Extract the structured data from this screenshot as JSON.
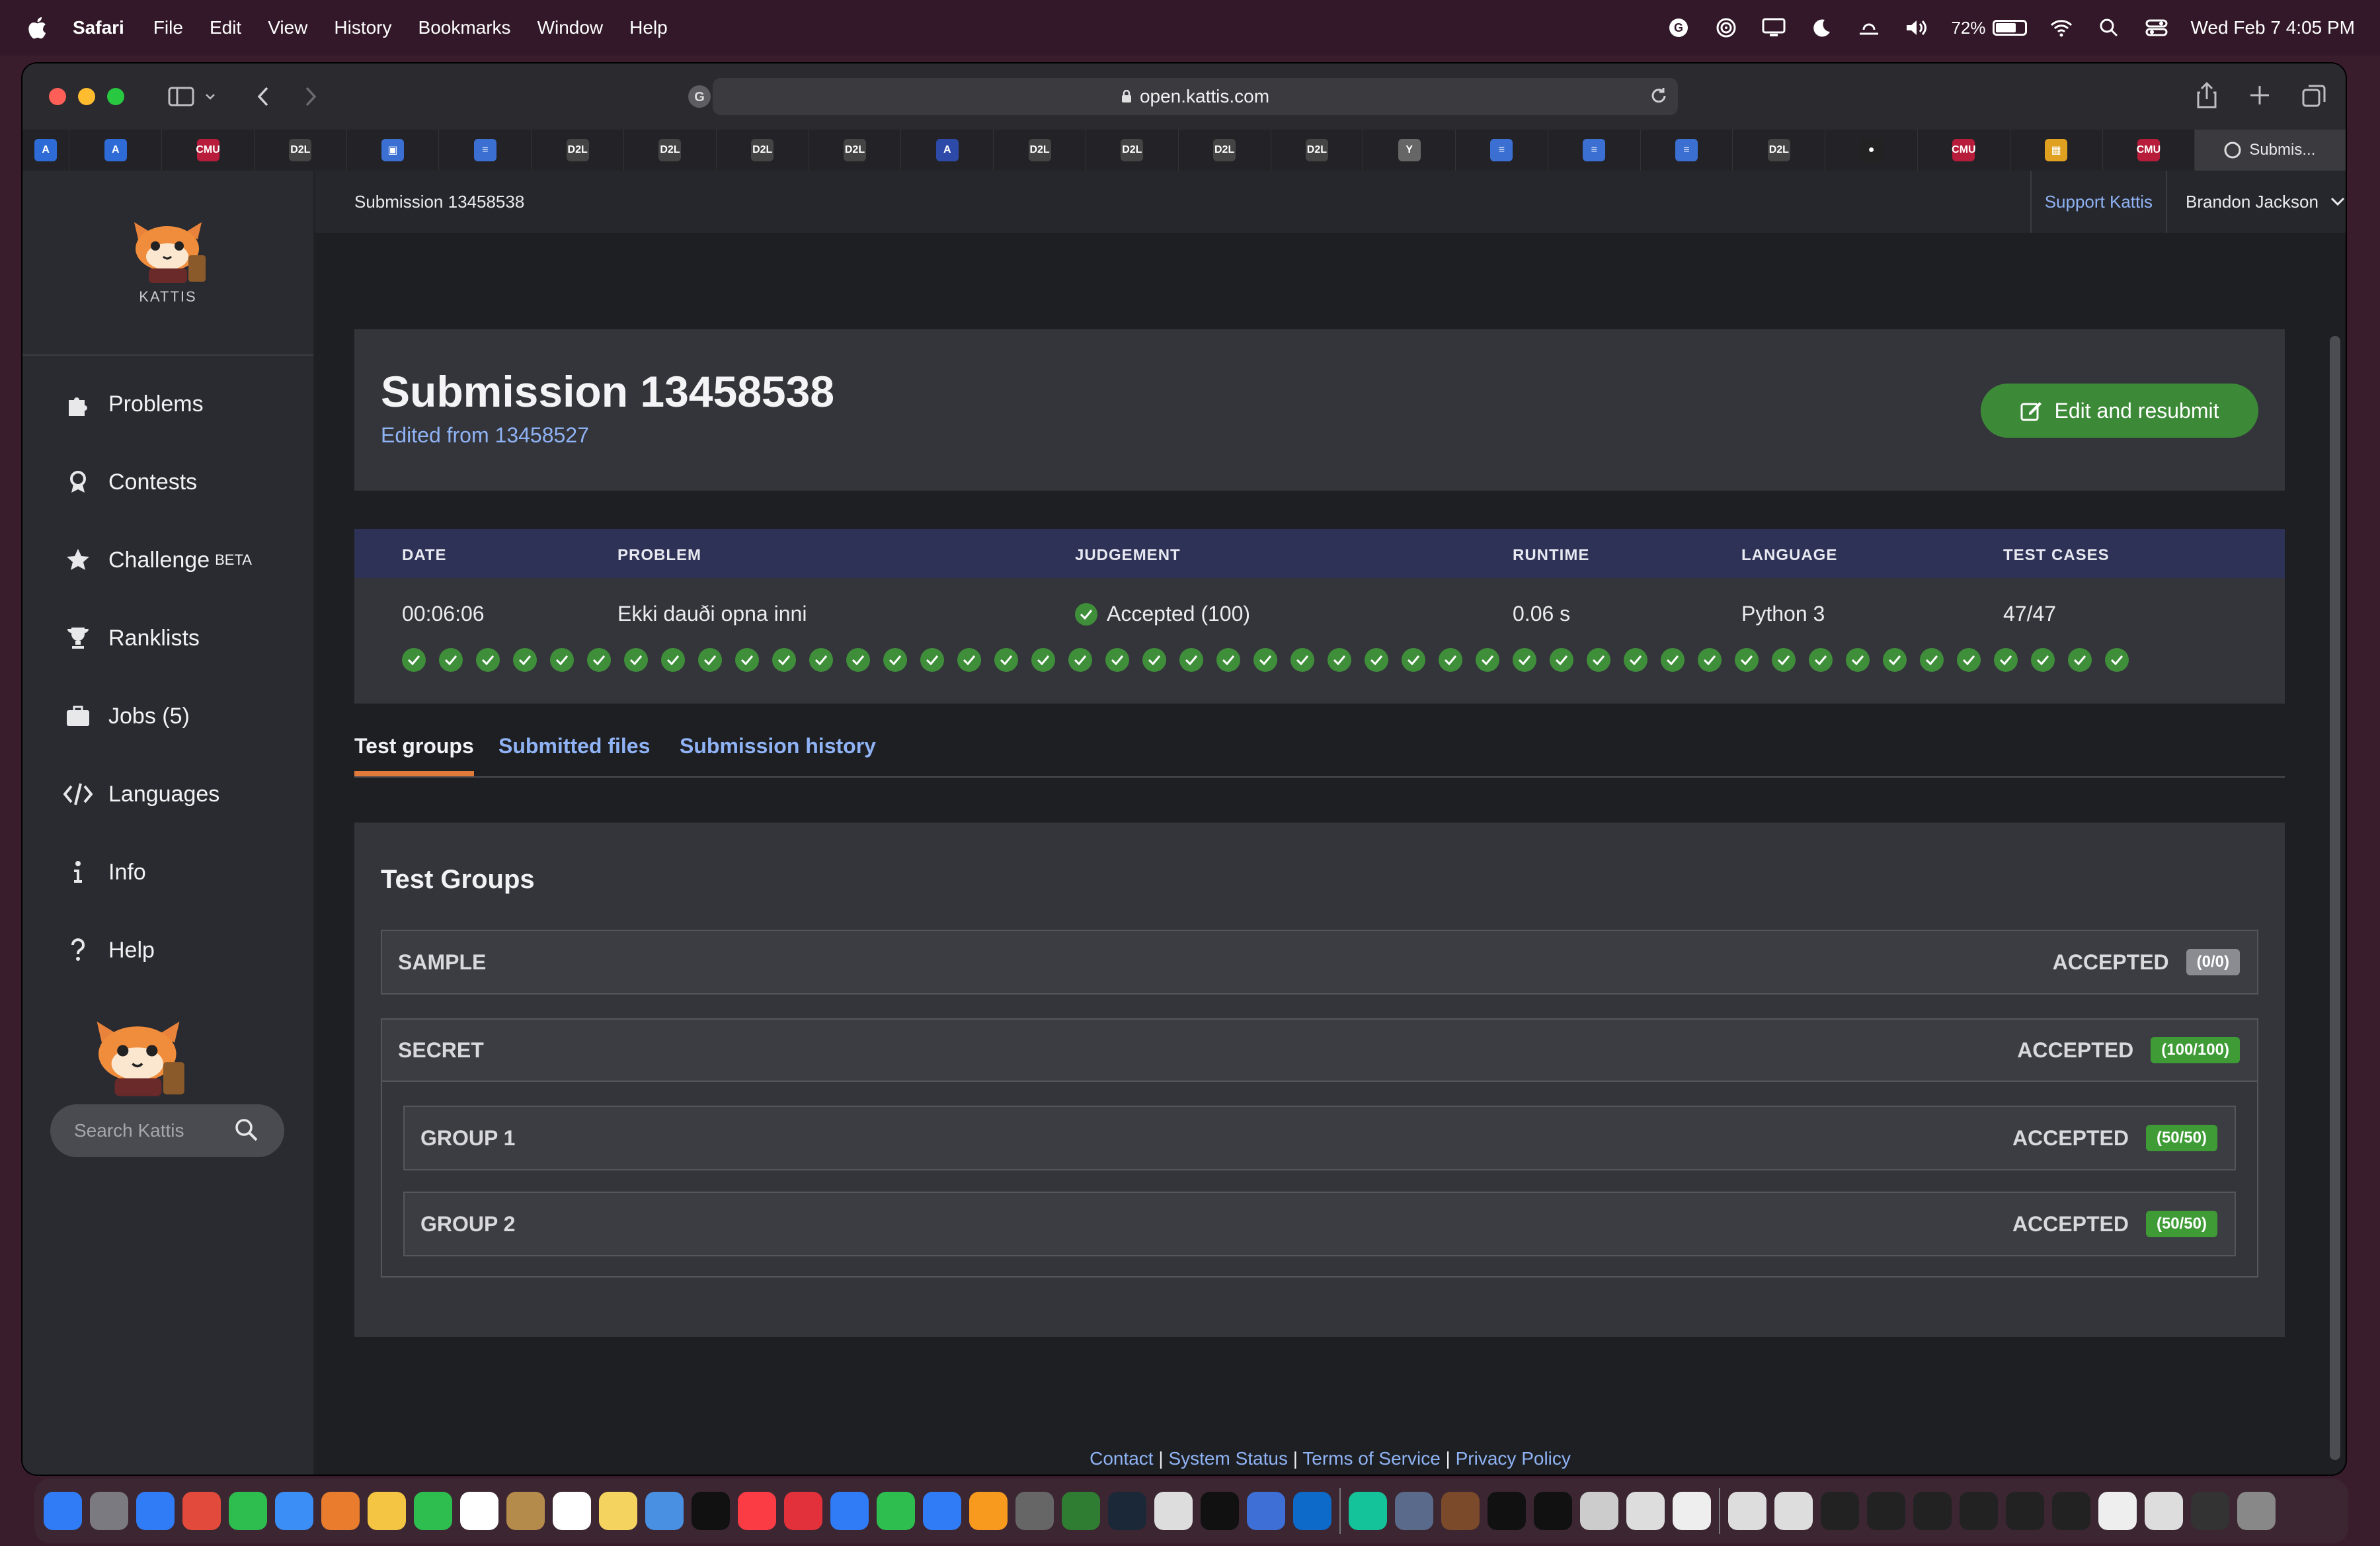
{
  "menubar": {
    "app_name": "Safari",
    "menus": [
      "File",
      "Edit",
      "View",
      "History",
      "Bookmarks",
      "Window",
      "Help"
    ],
    "battery": "72%",
    "datetime": "Wed Feb 7  4:05 PM"
  },
  "browser": {
    "url": "open.kattis.com",
    "active_tab_title": "Submis...",
    "favorites": [
      "A",
      "A",
      "CMU",
      "D2L",
      "▣",
      "≡",
      "D2L",
      "D2L",
      "D2L",
      "D2L",
      "A",
      "D2L",
      "D2L",
      "D2L",
      "D2L",
      "Y",
      "≡",
      "≡",
      "≡",
      "D2L",
      "●",
      "CMU",
      "▦",
      "CMU"
    ]
  },
  "sidebar": {
    "logo_text": "KATTIS",
    "items": [
      {
        "label": "Problems",
        "icon": "puzzle-icon"
      },
      {
        "label": "Contests",
        "icon": "award-icon"
      },
      {
        "label": "Challenge",
        "icon": "star-icon",
        "sup": "BETA"
      },
      {
        "label": "Ranklists",
        "icon": "trophy-icon"
      },
      {
        "label": "Jobs (5)",
        "icon": "briefcase-icon"
      },
      {
        "label": "Languages",
        "icon": "code-icon"
      },
      {
        "label": "Info",
        "icon": "info-icon"
      },
      {
        "label": "Help",
        "icon": "question-icon"
      }
    ],
    "search_placeholder": "Search Kattis"
  },
  "topbar": {
    "breadcrumb": "Submission 13458538",
    "support": "Support Kattis",
    "user": "Brandon Jackson"
  },
  "header": {
    "title": "Submission 13458538",
    "edited_from": "Edited from 13458527",
    "resubmit_label": "Edit and resubmit"
  },
  "submission": {
    "columns": [
      "DATE",
      "PROBLEM",
      "JUDGEMENT",
      "RUNTIME",
      "LANGUAGE",
      "TEST CASES"
    ],
    "date": "00:06:06",
    "problem": "Ekki dauði opna inni",
    "judgement": "Accepted (100)",
    "runtime": "0.06 s",
    "language": "Python 3",
    "test_cases": "47/47",
    "passed_case_count": 47
  },
  "tabs": [
    "Test groups",
    "Submitted files",
    "Submission history"
  ],
  "test_groups": {
    "heading": "Test Groups",
    "sample": {
      "name": "SAMPLE",
      "status": "ACCEPTED",
      "score": "(0/0)"
    },
    "secret": {
      "name": "SECRET",
      "status": "ACCEPTED",
      "score": "(100/100)"
    },
    "group1": {
      "name": "GROUP 1",
      "status": "ACCEPTED",
      "score": "(50/50)"
    },
    "group2": {
      "name": "GROUP 2",
      "status": "ACCEPTED",
      "score": "(50/50)"
    }
  },
  "footer": {
    "links": [
      "Contact",
      "System Status",
      "Terms of Service",
      "Privacy Policy"
    ],
    "separator": " | "
  },
  "colors": {
    "accent_green": "#3c8a37",
    "link_blue": "#8fb3f5",
    "tab_underline": "#e07a3a",
    "table_header": "#2e3256"
  }
}
